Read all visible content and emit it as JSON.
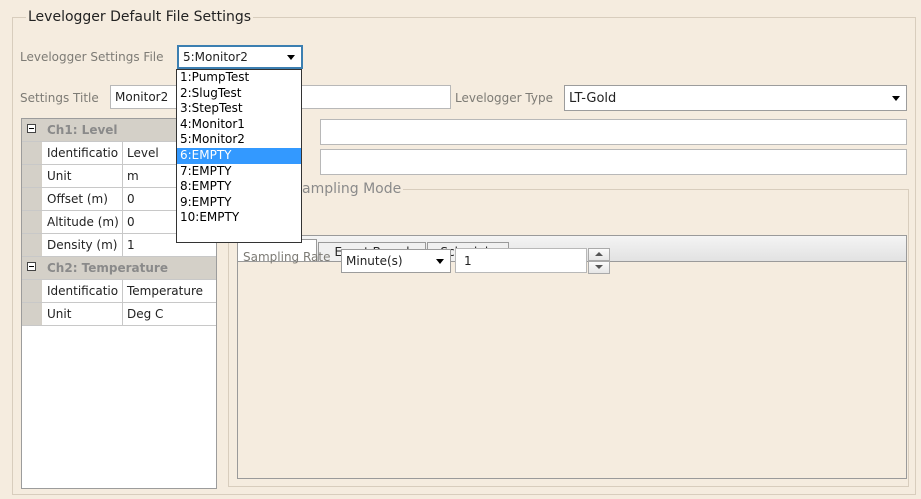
{
  "window_title": "Levelogger Default File Settings",
  "settings_file": {
    "label": "Levelogger Settings File",
    "selected": "5:Monitor2",
    "options": [
      "1:PumpTest",
      "2:SlugTest",
      "3:StepTest",
      "4:Monitor1",
      "5:Monitor2",
      "6:EMPTY",
      "7:EMPTY",
      "8:EMPTY",
      "9:EMPTY",
      "10:EMPTY"
    ],
    "highlighted_index": 5
  },
  "settings_title": {
    "label": "Settings Title",
    "value": "Monitor2"
  },
  "levelogger_type": {
    "label": "Levelogger Type",
    "value": "LT-Gold"
  },
  "property_grid": {
    "ch1": {
      "header": "Ch1: Level",
      "rows": [
        {
          "name": "Identificatio",
          "value": "Level"
        },
        {
          "name": "Unit",
          "value": "m"
        },
        {
          "name": "Offset (m)",
          "value": "0"
        },
        {
          "name": "Altitude (m)",
          "value": "0"
        },
        {
          "name": "Density (m)",
          "value": "1"
        }
      ]
    },
    "ch2": {
      "header": "Ch2: Temperature",
      "rows": [
        {
          "name": "Identificatio",
          "value": "Temperature"
        },
        {
          "name": "Unit",
          "value": "Deg C"
        }
      ]
    }
  },
  "sampling": {
    "group_title_visible": "ampling Mode",
    "tabs": [
      "Event Based",
      "Schedule"
    ],
    "rate_label": "Sampling Rate",
    "rate_unit": "Minute(s)",
    "rate_value": "1"
  }
}
